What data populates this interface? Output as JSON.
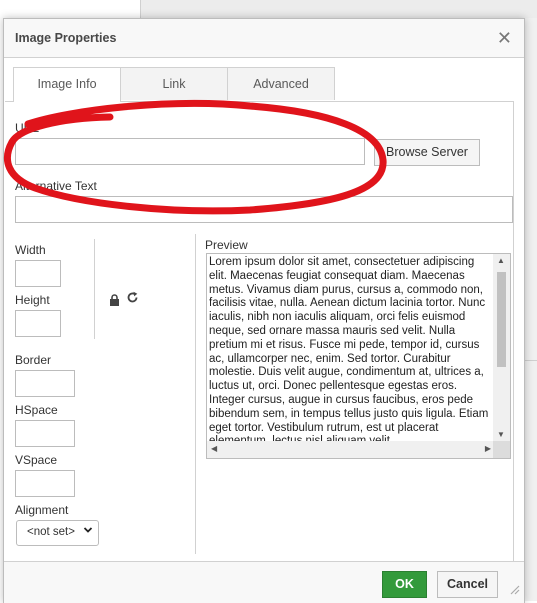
{
  "dialog": {
    "title": "Image Properties",
    "close_icon": "close-icon"
  },
  "tabs": [
    {
      "label": "Image Info",
      "active": true
    },
    {
      "label": "Link",
      "active": false
    },
    {
      "label": "Advanced",
      "active": false
    }
  ],
  "fields": {
    "url_label": "URL*",
    "url_value": "",
    "browse_label": "Browse Server",
    "alt_label": "Alternative Text",
    "alt_value": "",
    "width_label": "Width",
    "height_label": "Height",
    "border_label": "Border",
    "hspace_label": "HSpace",
    "vspace_label": "VSpace",
    "alignment_label": "Alignment",
    "alignment_value": "<not set>"
  },
  "preview": {
    "label": "Preview",
    "text": "Lorem ipsum dolor sit amet, consectetuer adipiscing elit. Maecenas feugiat consequat diam. Maecenas metus. Vivamus diam purus, cursus a, commodo non, facilisis vitae, nulla. Aenean dictum lacinia tortor. Nunc iaculis, nibh non iaculis aliquam, orci felis euismod neque, sed ornare massa mauris sed velit. Nulla pretium mi et risus. Fusce mi pede, tempor id, cursus ac, ullamcorper nec, enim. Sed tortor. Curabitur molestie. Duis velit augue, condimentum at, ultrices a, luctus ut, orci. Donec pellentesque egestas eros. Integer cursus, augue in cursus faucibus, eros pede bibendum sem, in tempus tellus justo quis ligula. Etiam eget tortor. Vestibulum rutrum, est ut placerat elementum, lectus nisl aliquam velit."
  },
  "footer": {
    "ok_label": "OK",
    "cancel_label": "Cancel"
  },
  "colors": {
    "ok_button": "#339a3b",
    "annotation": "#e0141b"
  },
  "icons": [
    "close-icon",
    "lock-icon",
    "reset-size-icon",
    "chevron-down-icon",
    "resize-grip-icon"
  ]
}
